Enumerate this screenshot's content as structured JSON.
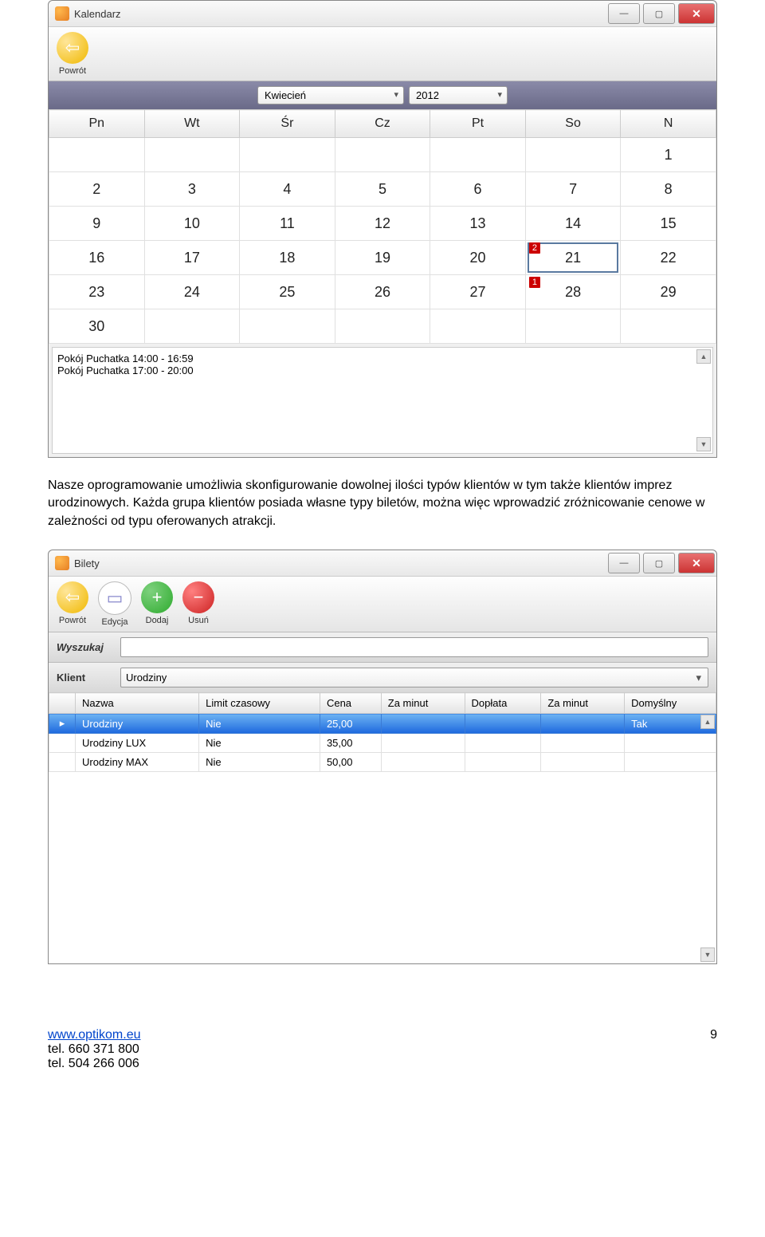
{
  "calendar_window": {
    "title": "Kalendarz",
    "back_label": "Powrót",
    "month": "Kwiecień",
    "year": "2012",
    "day_headers": [
      "Pn",
      "Wt",
      "Śr",
      "Cz",
      "Pt",
      "So",
      "N"
    ],
    "weeks": [
      [
        "",
        "",
        "",
        "",
        "",
        "",
        "1"
      ],
      [
        "2",
        "3",
        "4",
        "5",
        "6",
        "7",
        "8"
      ],
      [
        "9",
        "10",
        "11",
        "12",
        "13",
        "14",
        "15"
      ],
      [
        "16",
        "17",
        "18",
        "19",
        "20",
        "21",
        "22"
      ],
      [
        "23",
        "24",
        "25",
        "26",
        "27",
        "28",
        "29"
      ],
      [
        "30",
        "",
        "",
        "",
        "",
        "",
        ""
      ]
    ],
    "selected_day": "21",
    "badges": {
      "21": "2",
      "28": "1"
    },
    "events": [
      "Pokój Puchatka 14:00 - 16:59",
      "Pokój Puchatka 17:00 - 20:00"
    ]
  },
  "body_paragraph": "Nasze oprogramowanie umożliwia skonfigurowanie dowolnej ilości typów klientów w tym także klientów imprez urodzinowych. Każda grupa klientów posiada własne typy biletów, można więc wprowadzić zróżnicowanie cenowe w zależności od typu oferowanych atrakcji.",
  "tickets_window": {
    "title": "Bilety",
    "toolbar": {
      "back": "Powrót",
      "edit": "Edycja",
      "add": "Dodaj",
      "delete": "Usuń"
    },
    "search_label": "Wyszukaj",
    "search_value": "",
    "klient_label": "Klient",
    "klient_value": "Urodziny",
    "columns": [
      "Nazwa",
      "Limit czasowy",
      "Cena",
      "Za minut",
      "Dopłata",
      "Za minut",
      "Domyślny"
    ],
    "rows": [
      {
        "selected": true,
        "nazwa": "Urodziny",
        "limit": "Nie",
        "cena": "25,00",
        "zaminut1": "",
        "doplata": "",
        "zaminut2": "",
        "domyslny": "Tak"
      },
      {
        "selected": false,
        "nazwa": "Urodziny LUX",
        "limit": "Nie",
        "cena": "35,00",
        "zaminut1": "",
        "doplata": "",
        "zaminut2": "",
        "domyslny": ""
      },
      {
        "selected": false,
        "nazwa": "Urodziny MAX",
        "limit": "Nie",
        "cena": "50,00",
        "zaminut1": "",
        "doplata": "",
        "zaminut2": "",
        "domyslny": ""
      }
    ]
  },
  "footer": {
    "url": "www.optikom.eu",
    "tel1": "tel. 660 371 800",
    "tel2": "tel. 504 266 006",
    "page": "9"
  }
}
